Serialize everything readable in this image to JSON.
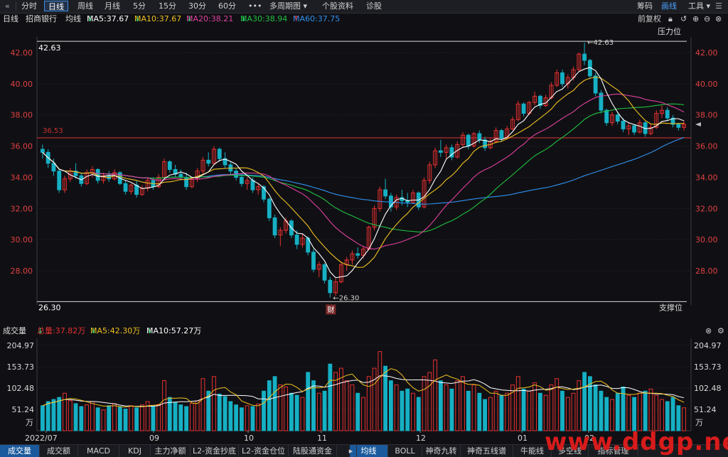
{
  "toolbar": {
    "back_icon": "double-chevron-left-icon",
    "tabs": [
      "分时",
      "日线",
      "周线",
      "月线",
      "5分",
      "15分",
      "30分",
      "60分",
      "•••",
      "多周期图",
      "个股资料",
      "诊股"
    ],
    "active_tab": "日线",
    "right": {
      "chouma": "筹码",
      "huaxian": "画线",
      "gongju": "工具"
    }
  },
  "ma_legend": {
    "period": "日线",
    "stock_name": "招商银行",
    "ma_label": "均线",
    "ma5": "MA5:37.67",
    "ma10": "MA10:37.67",
    "ma20": "MA20:38.21",
    "ma30": "MA30:38.94",
    "ma60": "MA60:37.75",
    "fuquan": "前复权",
    "colors": {
      "ma5": "#ffffff",
      "ma10": "#f0c020",
      "ma20": "#e040a0",
      "ma30": "#20c040",
      "ma60": "#3090f0"
    }
  },
  "price_chart": {
    "y_ticks": [
      "42.00",
      "40.00",
      "38.00",
      "36.00",
      "34.00",
      "32.00",
      "30.00",
      "28.00"
    ],
    "y_values": [
      42,
      40,
      38,
      36,
      34,
      32,
      30,
      28
    ],
    "ymin": 26.0,
    "ymax": 43.0,
    "high_label": "42.63",
    "high_value": 42.63,
    "low_label": "26.30",
    "low_value": 26.3,
    "left_high_label": "42.63",
    "left_low_label": "26.30",
    "red_line_label": "36.53",
    "red_line_value": 36.53,
    "pressure_label": "压力位",
    "support_label": "支撑位",
    "event_label": "财",
    "candles": [
      [
        35.8,
        36.1,
        35.2,
        35.6
      ],
      [
        35.6,
        35.8,
        34.6,
        34.9
      ],
      [
        34.9,
        35.2,
        34.1,
        34.4
      ],
      [
        34.4,
        34.5,
        33.0,
        33.2
      ],
      [
        33.2,
        34.1,
        33.0,
        33.9
      ],
      [
        33.9,
        34.6,
        33.7,
        34.4
      ],
      [
        34.4,
        34.9,
        33.9,
        34.1
      ],
      [
        34.1,
        34.3,
        33.4,
        33.6
      ],
      [
        33.6,
        34.5,
        33.5,
        34.3
      ],
      [
        34.3,
        34.7,
        34.0,
        34.5
      ],
      [
        34.5,
        34.6,
        33.6,
        33.8
      ],
      [
        33.8,
        34.3,
        33.6,
        34.1
      ],
      [
        34.1,
        34.4,
        33.7,
        33.9
      ],
      [
        33.9,
        34.5,
        33.8,
        34.3
      ],
      [
        34.3,
        34.4,
        33.5,
        33.6
      ],
      [
        33.6,
        33.8,
        32.9,
        33.1
      ],
      [
        33.1,
        33.6,
        32.9,
        33.5
      ],
      [
        33.5,
        33.8,
        32.7,
        32.9
      ],
      [
        32.9,
        33.5,
        32.8,
        33.3
      ],
      [
        33.3,
        34.0,
        33.1,
        33.8
      ],
      [
        33.8,
        34.0,
        33.2,
        33.4
      ],
      [
        33.4,
        34.2,
        33.3,
        34.0
      ],
      [
        34.0,
        35.2,
        33.9,
        35.0
      ],
      [
        35.0,
        35.1,
        34.3,
        34.5
      ],
      [
        34.5,
        34.8,
        34.0,
        34.2
      ],
      [
        34.2,
        34.5,
        33.8,
        34.0
      ],
      [
        34.0,
        34.3,
        33.2,
        33.4
      ],
      [
        33.4,
        34.0,
        33.3,
        33.9
      ],
      [
        33.9,
        34.6,
        33.7,
        34.4
      ],
      [
        34.4,
        35.3,
        34.2,
        35.1
      ],
      [
        35.1,
        35.6,
        34.7,
        34.9
      ],
      [
        34.9,
        36.0,
        34.8,
        35.8
      ],
      [
        35.8,
        35.9,
        35.0,
        35.2
      ],
      [
        35.2,
        35.6,
        34.6,
        34.8
      ],
      [
        34.8,
        35.0,
        34.2,
        34.4
      ],
      [
        34.4,
        34.6,
        33.8,
        34.0
      ],
      [
        34.0,
        34.3,
        33.4,
        33.6
      ],
      [
        33.6,
        34.0,
        33.2,
        33.8
      ],
      [
        33.8,
        34.0,
        33.0,
        33.2
      ],
      [
        33.2,
        33.6,
        32.9,
        33.4
      ],
      [
        33.4,
        33.5,
        32.4,
        32.6
      ],
      [
        32.6,
        32.7,
        31.2,
        31.4
      ],
      [
        31.4,
        31.6,
        30.1,
        30.3
      ],
      [
        30.3,
        30.8,
        29.6,
        30.6
      ],
      [
        30.6,
        31.4,
        30.4,
        31.2
      ],
      [
        31.2,
        31.3,
        30.1,
        30.3
      ],
      [
        30.3,
        30.6,
        29.4,
        29.7
      ],
      [
        29.7,
        30.4,
        29.5,
        30.1
      ],
      [
        30.1,
        30.2,
        29.0,
        29.2
      ],
      [
        29.2,
        29.4,
        27.9,
        28.1
      ],
      [
        28.1,
        28.6,
        27.6,
        28.4
      ],
      [
        28.4,
        28.5,
        27.2,
        27.4
      ],
      [
        27.4,
        27.6,
        26.3,
        26.6
      ],
      [
        26.6,
        27.5,
        26.4,
        27.3
      ],
      [
        27.3,
        28.6,
        27.2,
        28.4
      ],
      [
        28.4,
        28.9,
        28.0,
        28.7
      ],
      [
        28.7,
        29.3,
        28.4,
        29.1
      ],
      [
        29.1,
        29.5,
        28.8,
        29.0
      ],
      [
        29.0,
        29.6,
        28.8,
        29.4
      ],
      [
        29.4,
        30.9,
        29.3,
        30.8
      ],
      [
        30.8,
        32.2,
        30.6,
        32.0
      ],
      [
        32.0,
        33.4,
        31.8,
        33.2
      ],
      [
        33.2,
        33.9,
        32.6,
        32.8
      ],
      [
        32.8,
        33.0,
        31.8,
        32.1
      ],
      [
        32.1,
        32.9,
        31.9,
        32.7
      ],
      [
        32.7,
        33.2,
        32.2,
        32.5
      ],
      [
        32.5,
        33.0,
        32.1,
        32.4
      ],
      [
        32.4,
        33.2,
        32.3,
        33.0
      ],
      [
        33.0,
        33.1,
        31.9,
        32.1
      ],
      [
        32.1,
        34.0,
        32.0,
        33.8
      ],
      [
        33.8,
        35.0,
        33.6,
        34.8
      ],
      [
        34.8,
        35.9,
        34.6,
        35.7
      ],
      [
        35.7,
        36.4,
        35.3,
        35.6
      ],
      [
        35.6,
        36.1,
        35.2,
        35.9
      ],
      [
        35.9,
        36.1,
        35.1,
        35.3
      ],
      [
        35.3,
        36.3,
        35.2,
        36.1
      ],
      [
        36.1,
        36.9,
        35.9,
        36.7
      ],
      [
        36.7,
        36.8,
        35.8,
        36.0
      ],
      [
        36.0,
        36.9,
        35.9,
        36.8
      ],
      [
        36.8,
        37.0,
        36.2,
        36.4
      ],
      [
        36.4,
        36.6,
        35.7,
        35.9
      ],
      [
        35.9,
        36.5,
        35.8,
        36.3
      ],
      [
        36.3,
        37.2,
        36.2,
        37.0
      ],
      [
        37.0,
        37.1,
        36.3,
        36.5
      ],
      [
        36.5,
        37.3,
        36.4,
        37.1
      ],
      [
        37.1,
        37.9,
        37.0,
        37.7
      ],
      [
        37.7,
        38.9,
        37.6,
        38.7
      ],
      [
        38.7,
        38.8,
        37.9,
        38.1
      ],
      [
        38.1,
        38.9,
        38.0,
        38.8
      ],
      [
        38.8,
        39.5,
        38.6,
        39.2
      ],
      [
        39.2,
        39.3,
        38.4,
        38.6
      ],
      [
        38.6,
        39.3,
        38.5,
        39.1
      ],
      [
        39.1,
        40.1,
        39.0,
        39.9
      ],
      [
        39.9,
        40.9,
        39.8,
        40.7
      ],
      [
        40.7,
        40.9,
        39.8,
        40.0
      ],
      [
        40.0,
        40.6,
        39.7,
        40.4
      ],
      [
        40.4,
        41.1,
        40.2,
        40.9
      ],
      [
        40.9,
        42.0,
        40.8,
        41.9
      ],
      [
        41.9,
        42.63,
        41.2,
        41.5
      ],
      [
        41.5,
        41.6,
        40.3,
        40.5
      ],
      [
        40.5,
        40.7,
        39.2,
        39.4
      ],
      [
        39.4,
        39.6,
        38.1,
        38.3
      ],
      [
        38.3,
        38.4,
        37.3,
        37.5
      ],
      [
        37.5,
        38.2,
        37.3,
        38.0
      ],
      [
        38.0,
        38.1,
        37.4,
        37.6
      ],
      [
        37.6,
        37.8,
        36.9,
        37.1
      ],
      [
        37.1,
        37.5,
        36.7,
        37.3
      ],
      [
        37.3,
        37.4,
        36.7,
        36.9
      ],
      [
        36.9,
        37.7,
        36.8,
        37.5
      ],
      [
        37.5,
        37.6,
        36.6,
        36.8
      ],
      [
        36.8,
        37.4,
        36.7,
        37.2
      ],
      [
        37.2,
        38.3,
        37.1,
        38.1
      ],
      [
        38.1,
        38.6,
        37.8,
        38.3
      ],
      [
        38.3,
        38.5,
        37.6,
        37.8
      ],
      [
        37.8,
        38.0,
        37.2,
        37.4
      ],
      [
        37.4,
        37.5,
        37.0,
        37.2
      ],
      [
        37.2,
        37.6,
        37.0,
        37.4
      ]
    ]
  },
  "volume_panel": {
    "title": "成交量",
    "total": "总量:37.82万",
    "ma5": "MA5:42.30万",
    "ma10": "MA10:57.27万",
    "y_ticks": [
      "204.97",
      "153.73",
      "102.48",
      "51.24",
      "万"
    ],
    "y_values": [
      204.97,
      153.73,
      102.48,
      51.24
    ],
    "vmax": 215,
    "volumes": [
      60,
      70,
      75,
      80,
      90,
      72,
      65,
      58,
      62,
      70,
      55,
      50,
      60,
      65,
      58,
      52,
      60,
      55,
      62,
      70,
      58,
      63,
      120,
      80,
      68,
      62,
      58,
      66,
      72,
      125,
      95,
      130,
      88,
      82,
      70,
      62,
      55,
      60,
      58,
      64,
      95,
      120,
      130,
      110,
      105,
      90,
      85,
      80,
      140,
      120,
      90,
      95,
      160,
      140,
      150,
      120,
      110,
      90,
      80,
      130,
      150,
      190,
      155,
      120,
      110,
      95,
      100,
      90,
      80,
      130,
      140,
      170,
      120,
      110,
      100,
      120,
      130,
      95,
      110,
      90,
      75,
      80,
      95,
      85,
      90,
      110,
      130,
      100,
      95,
      115,
      90,
      85,
      110,
      125,
      95,
      80,
      90,
      120,
      140,
      130,
      110,
      95,
      80,
      75,
      90,
      105,
      85,
      80,
      90,
      95,
      100,
      85,
      75,
      70,
      80,
      60,
      55
    ],
    "x_labels": [
      "2022/07",
      "09",
      "10",
      "11",
      "12",
      "01",
      "02"
    ],
    "colors": {
      "ma5": "#f0c020",
      "ma10": "#ffffff"
    }
  },
  "bottom_tabs": [
    "成交量",
    "成交额",
    "MACD",
    "KDJ",
    "主力净额",
    "L2-资金抄底",
    "L2-资金仓位",
    "陆股通资金",
    "均线",
    "BOLL",
    "神奇九转",
    "神奇五线谱",
    "牛能线",
    "多空线",
    "指标管理"
  ],
  "bottom_tabs_active": [
    "成交量",
    "均线"
  ],
  "watermark": "www.ddgp.net",
  "colors": {
    "up": "#e83030",
    "down": "#16b0c4",
    "axis_text": "#e04040",
    "grid": "#2a2c33",
    "bg": "#101014"
  }
}
